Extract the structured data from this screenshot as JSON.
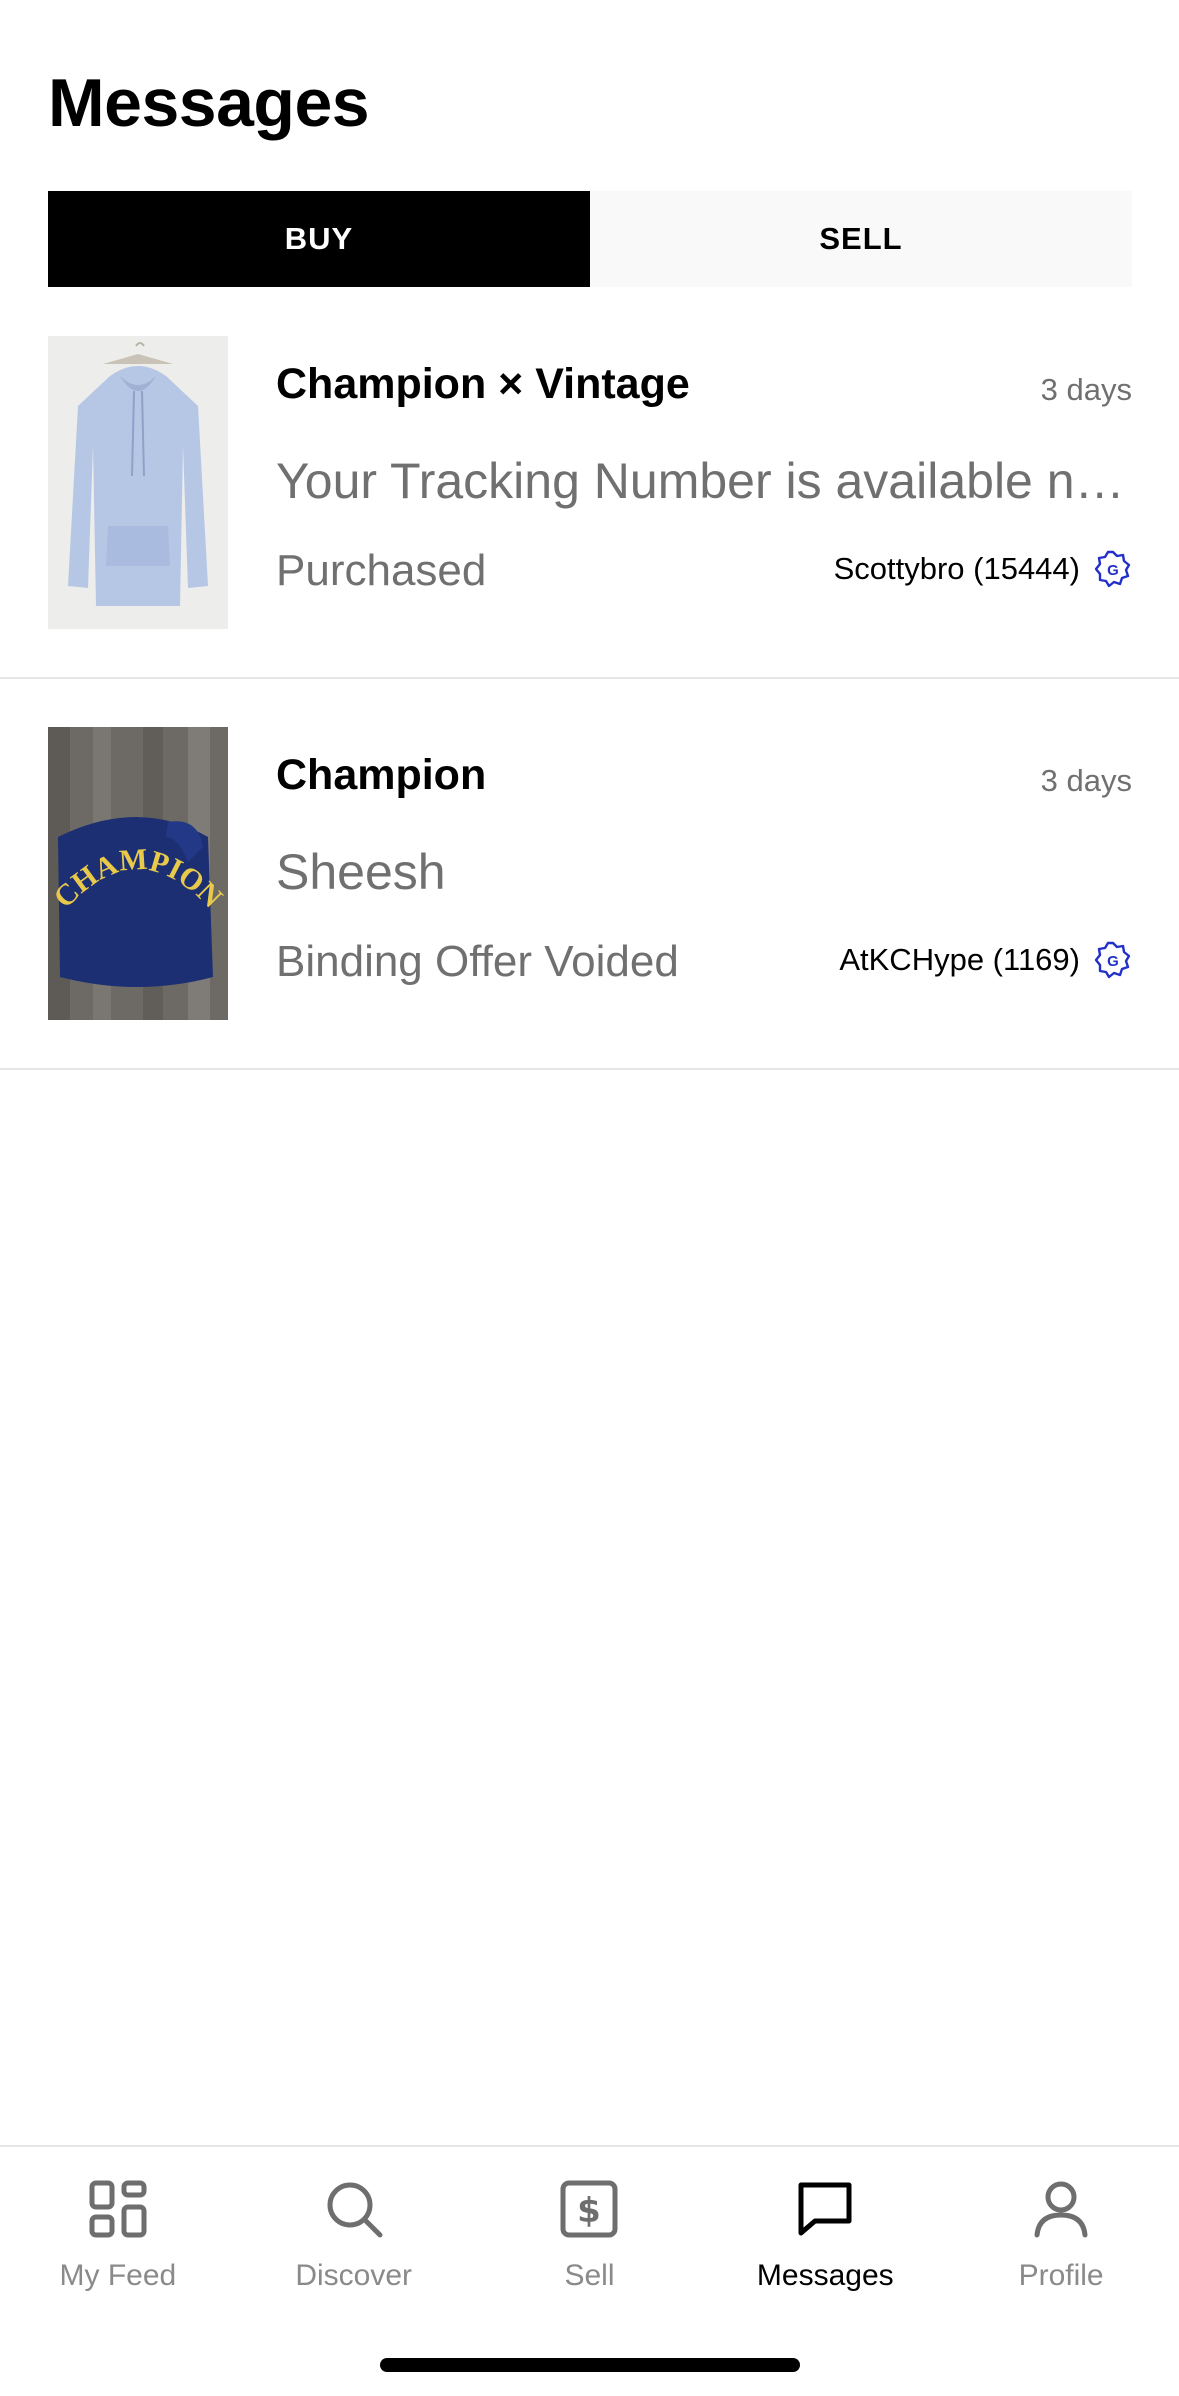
{
  "header": {
    "title": "Messages"
  },
  "segmented": {
    "buy_label": "BUY",
    "sell_label": "SELL",
    "selected": "BUY"
  },
  "messages": [
    {
      "title": "Champion × Vintage",
      "time": "3 days",
      "preview": "Your Tracking Number is available now",
      "status": "Purchased",
      "seller": "Scottybro (15444)",
      "thumbnail": "light-blue-hoodie-image"
    },
    {
      "title": "Champion",
      "time": "3 days",
      "preview": "Sheesh",
      "status": "Binding Offer Voided",
      "seller": "AtKCHype (1169)",
      "thumbnail": "navy-champion-sweatshirt-image"
    }
  ],
  "tabbar": {
    "items": [
      {
        "label": "My Feed",
        "icon": "grid-icon"
      },
      {
        "label": "Discover",
        "icon": "search-icon"
      },
      {
        "label": "Sell",
        "icon": "dollar-tag-icon"
      },
      {
        "label": "Messages",
        "icon": "chat-bubble-icon"
      },
      {
        "label": "Profile",
        "icon": "person-icon"
      }
    ],
    "active": "Messages"
  },
  "colors": {
    "accent_active": "#000000",
    "muted_text": "#707070",
    "badge_blue": "#2030c8",
    "divider": "#e6e6e6"
  }
}
